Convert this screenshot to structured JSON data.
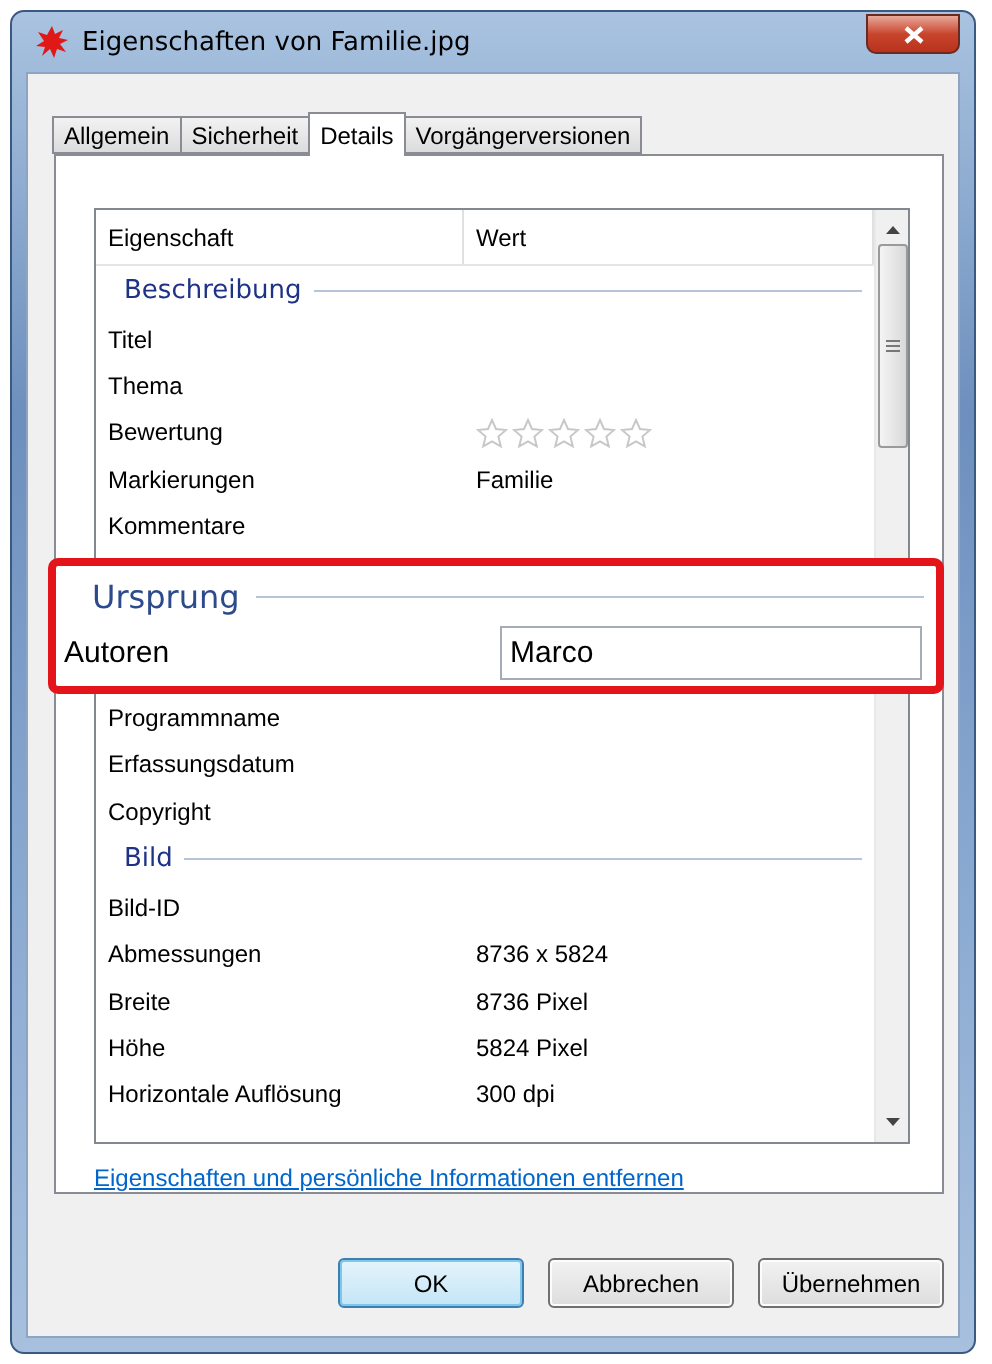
{
  "window": {
    "title": "Eigenschaften von Familie.jpg"
  },
  "tabs": [
    {
      "label": "Allgemein",
      "selected": false
    },
    {
      "label": "Sicherheit",
      "selected": false
    },
    {
      "label": "Details",
      "selected": true
    },
    {
      "label": "Vorgängerversionen",
      "selected": false
    }
  ],
  "list": {
    "columns": [
      "Eigenschaft",
      "Wert"
    ],
    "groups": [
      {
        "kind": "group",
        "title": "Beschreibung",
        "rows": [
          {
            "name": "Titel"
          },
          {
            "name": "Thema"
          },
          {
            "name": "Bewertung",
            "stars": 0
          },
          {
            "name": "Markierungen",
            "value": "Familie"
          },
          {
            "name": "Kommentare"
          }
        ]
      },
      {
        "kind": "hidden"
      },
      {
        "kind": "rows",
        "rows": [
          {
            "name": "Programmname"
          },
          {
            "name": "Erfassungsdatum"
          },
          {
            "name": "Copyright"
          }
        ]
      },
      {
        "kind": "group",
        "title": "Bild",
        "rows": [
          {
            "name": "Bild-ID"
          },
          {
            "name": "Abmessungen",
            "value": "8736 x 5824"
          },
          {
            "name": "Breite",
            "value": "8736 Pixel"
          },
          {
            "name": "Höhe",
            "value": "5824 Pixel"
          },
          {
            "name": "Horizontale Auflösung",
            "value": "300 dpi"
          }
        ]
      }
    ]
  },
  "magnified": {
    "title": "Ursprung",
    "label": "Autoren",
    "value": "Marco"
  },
  "link": "Eigenschaften und persönliche Informationen entfernen",
  "buttons": [
    {
      "label": "OK",
      "default": true
    },
    {
      "label": "Abbrechen",
      "default": false
    },
    {
      "label": "Übernehmen",
      "default": false
    }
  ]
}
